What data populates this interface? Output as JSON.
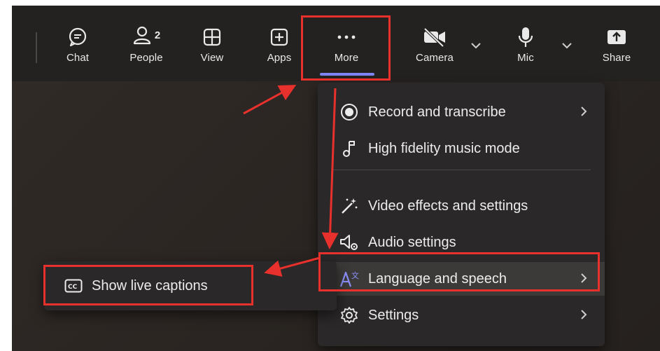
{
  "toolbar": {
    "buttons": [
      {
        "label": "Chat",
        "icon": "chat-icon"
      },
      {
        "label": "People",
        "icon": "people-icon",
        "count": "2"
      },
      {
        "label": "View",
        "icon": "view-grid-icon"
      },
      {
        "label": "Apps",
        "icon": "apps-plus-icon"
      },
      {
        "label": "More",
        "icon": "more-dots-icon"
      },
      {
        "label": "Camera",
        "icon": "camera-off-icon"
      },
      {
        "label": "Mic",
        "icon": "mic-icon"
      },
      {
        "label": "Share",
        "icon": "share-icon"
      }
    ]
  },
  "more_menu": {
    "items": [
      {
        "label": "Record and transcribe",
        "icon": "record-icon",
        "has_submenu": true
      },
      {
        "label": "High fidelity music mode",
        "icon": "music-note-icon",
        "has_submenu": false
      },
      {
        "label": "Video effects and settings",
        "icon": "magic-wand-icon",
        "has_submenu": false
      },
      {
        "label": "Audio settings",
        "icon": "speaker-settings-icon",
        "has_submenu": false
      },
      {
        "label": "Language and speech",
        "icon": "language-icon",
        "has_submenu": true
      },
      {
        "label": "Settings",
        "icon": "gear-icon",
        "has_submenu": true
      }
    ]
  },
  "language_submenu": {
    "items": [
      {
        "label": "Show live captions",
        "icon": "closed-captions-icon"
      }
    ]
  },
  "colors": {
    "toolbar_bg": "#232220",
    "menu_bg": "#2a2828",
    "accent": "#7f85f5",
    "highlight_box": "#e8302c"
  }
}
